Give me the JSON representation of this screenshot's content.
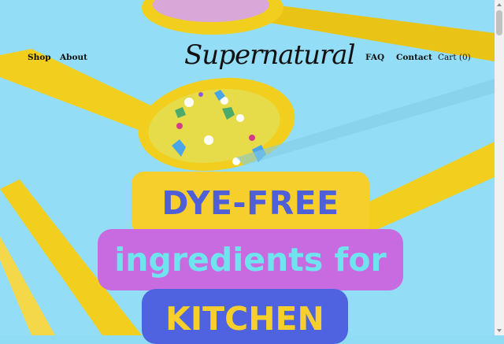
{
  "brand": {
    "logo_text": "Supernatural"
  },
  "nav": {
    "shop": "Shop",
    "about": "About",
    "faq": "FAQ",
    "contact": "Contact",
    "cart": "Cart (0)"
  },
  "hero": {
    "line1": "DYE-FREE",
    "line2": "ingredients for",
    "line3": "KITCHEN",
    "image_alt": "yellow spoons holding colorful sprinkles",
    "colors": {
      "background": "#93def6",
      "spoon": "#f2cf1e",
      "pill1": "#f6cf2c",
      "pill2": "#c86be0",
      "pill3": "#4f63e0"
    }
  },
  "scrollbar": {
    "icons": [
      "scroll-up-arrow",
      "scroll-down-arrow"
    ]
  }
}
